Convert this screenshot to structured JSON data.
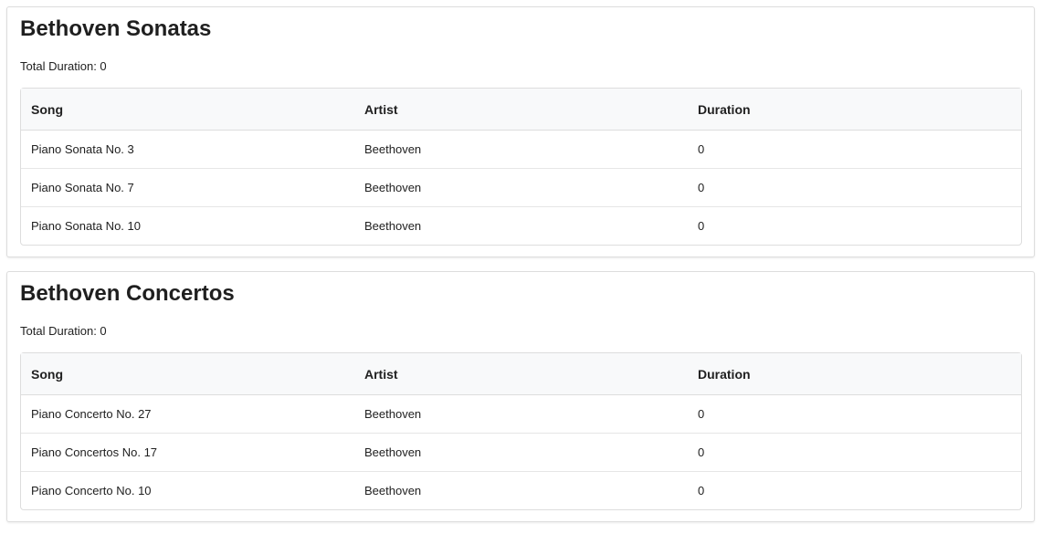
{
  "playlists": [
    {
      "title": "Bethoven Sonatas",
      "total_label": "Total Duration: 0",
      "columns": [
        "Song",
        "Artist",
        "Duration"
      ],
      "rows": [
        [
          "Piano Sonata No. 3",
          "Beethoven",
          "0"
        ],
        [
          "Piano Sonata No. 7",
          "Beethoven",
          "0"
        ],
        [
          "Piano Sonata No. 10",
          "Beethoven",
          "0"
        ]
      ]
    },
    {
      "title": "Bethoven Concertos",
      "total_label": "Total Duration: 0",
      "columns": [
        "Song",
        "Artist",
        "Duration"
      ],
      "rows": [
        [
          "Piano Concerto No. 27",
          "Beethoven",
          "0"
        ],
        [
          "Piano Concertos No. 17",
          "Beethoven",
          "0"
        ],
        [
          "Piano Concerto No. 10",
          "Beethoven",
          "0"
        ]
      ]
    }
  ]
}
